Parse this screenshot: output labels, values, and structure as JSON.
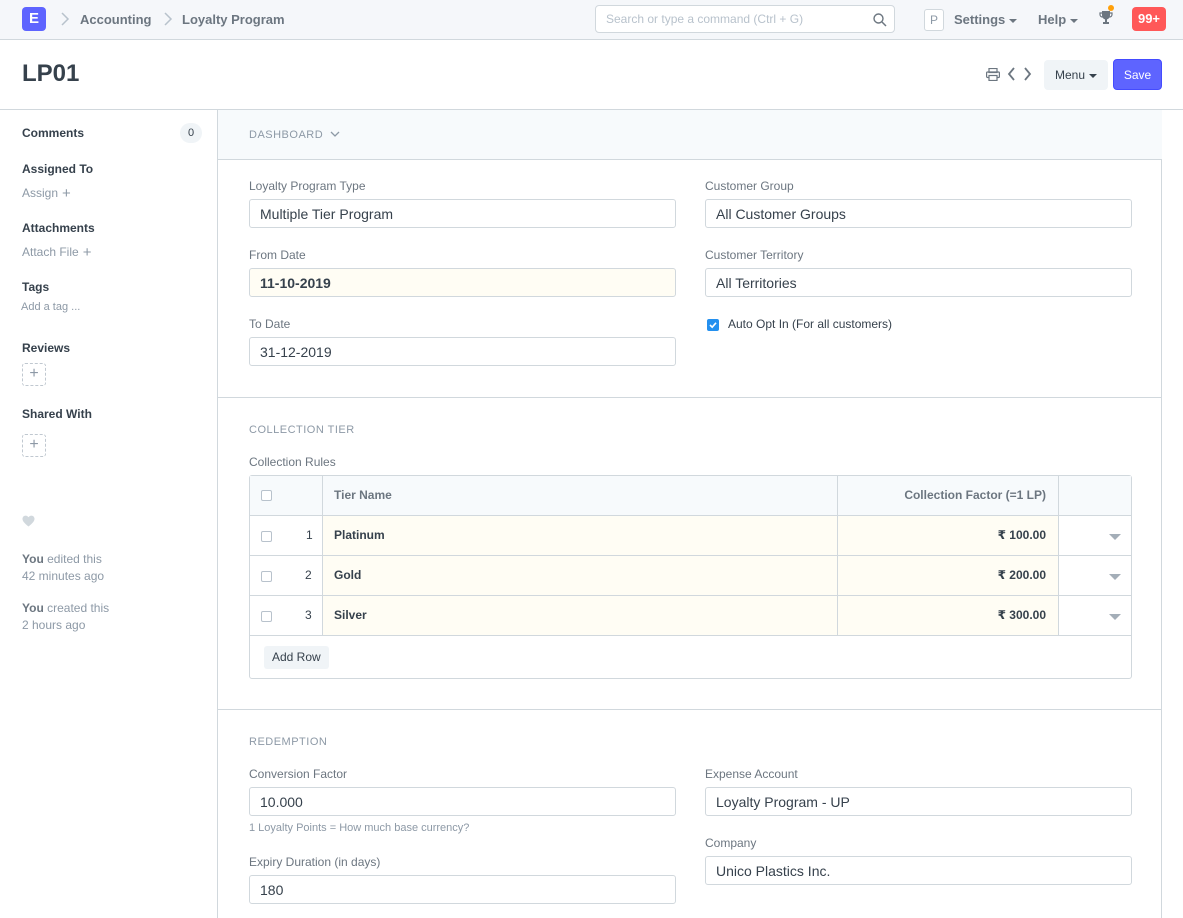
{
  "navbar": {
    "logo": "E",
    "breadcrumbs": [
      "Accounting",
      "Loyalty Program"
    ],
    "search_placeholder": "Search or type a command (Ctrl + G)",
    "avatar": "P",
    "settings_label": "Settings",
    "help_label": "Help",
    "notification_count": "99+"
  },
  "page": {
    "title": "LP01",
    "menu_label": "Menu",
    "save_label": "Save"
  },
  "sidebar": {
    "comments_label": "Comments",
    "comments_count": "0",
    "assigned_to_label": "Assigned To",
    "assign_link": "Assign",
    "attachments_label": "Attachments",
    "attach_link": "Attach File",
    "tags_label": "Tags",
    "add_tag_link": "Add a tag ...",
    "reviews_label": "Reviews",
    "shared_with_label": "Shared With",
    "activity": [
      {
        "who": "You",
        "action": " edited this",
        "when": "42 minutes ago"
      },
      {
        "who": "You",
        "action": " created this",
        "when": "2 hours ago"
      }
    ]
  },
  "form": {
    "dashboard_label": "DASHBOARD",
    "loyalty_program_type": {
      "label": "Loyalty Program Type",
      "value": "Multiple Tier Program"
    },
    "from_date": {
      "label": "From Date",
      "value": "11-10-2019"
    },
    "to_date": {
      "label": "To Date",
      "value": "31-12-2019"
    },
    "customer_group": {
      "label": "Customer Group",
      "value": "All Customer Groups"
    },
    "customer_territory": {
      "label": "Customer Territory",
      "value": "All Territories"
    },
    "auto_opt_in": {
      "label": "Auto Opt In (For all customers)",
      "checked": true
    },
    "collection_section": "COLLECTION TIER",
    "collection_rules_label": "Collection Rules",
    "grid": {
      "col_tier_name": "Tier Name",
      "col_collection_factor": "Collection Factor (=1 LP)",
      "rows": [
        {
          "idx": "1",
          "tier_name": "Platinum",
          "factor": "₹ 100.00"
        },
        {
          "idx": "2",
          "tier_name": "Gold",
          "factor": "₹ 200.00"
        },
        {
          "idx": "3",
          "tier_name": "Silver",
          "factor": "₹ 300.00"
        }
      ],
      "add_row_label": "Add Row"
    },
    "redemption_section": "REDEMPTION",
    "conversion_factor": {
      "label": "Conversion Factor",
      "value": "10.000",
      "help": "1 Loyalty Points = How much base currency?"
    },
    "expiry_duration": {
      "label": "Expiry Duration (in days)",
      "value": "180"
    },
    "expense_account": {
      "label": "Expense Account",
      "value": "Loyalty Program - UP"
    },
    "company": {
      "label": "Company",
      "value": "Unico Plastics Inc."
    }
  },
  "colors": {
    "primary": "#5e64ff",
    "badge": "#ff5858",
    "checkbox": "#2490ef",
    "highlight": "#fffdf4"
  }
}
